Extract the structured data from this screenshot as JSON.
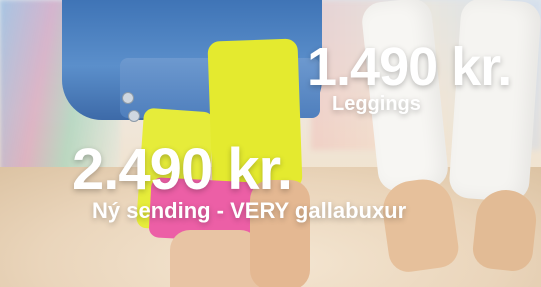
{
  "promos": [
    {
      "price": "1.490 kr.",
      "label": "Leggings"
    },
    {
      "price": "2.490 kr.",
      "label": "Ný sending - VERY gallabuxur"
    }
  ],
  "colors": {
    "price_text": "#ffffff",
    "leggings_yellow": "#e6ec3a",
    "leggings_pink": "#ec5fa6",
    "denim_blue": "#3f74b6",
    "white_leggings": "#f7f6f3",
    "sand": "#ead5bb"
  }
}
